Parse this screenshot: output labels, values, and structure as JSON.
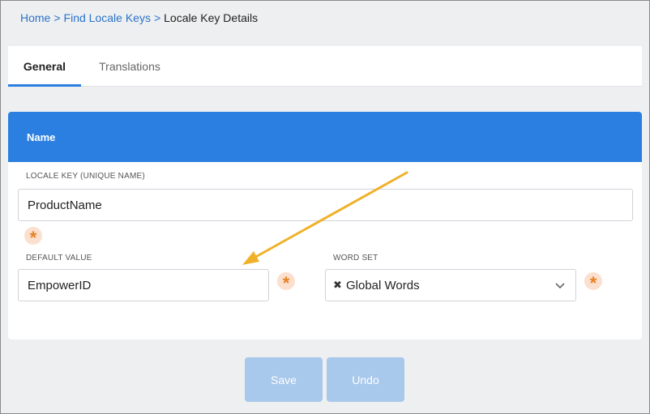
{
  "breadcrumb": {
    "home": "Home",
    "sep1": ">",
    "find": "Find Locale Keys",
    "sep2": ">",
    "current": "Locale Key Details"
  },
  "tabs": {
    "general": "General",
    "translations": "Translations"
  },
  "card": {
    "title": "Name",
    "locale_key": {
      "label": "LOCALE KEY (UNIQUE NAME)",
      "value": "ProductName"
    },
    "default_value": {
      "label": "DEFAULT VALUE",
      "value": "EmpowerID"
    },
    "word_set": {
      "label": "WORD SET",
      "clear": "✖",
      "value": "Global Words"
    },
    "required_mark": "*"
  },
  "actions": {
    "save": "Save",
    "undo": "Undo"
  },
  "colors": {
    "accent": "#2b7fe0",
    "link": "#2a73c9",
    "required": "#e8801f",
    "disabled_button": "#a8c8ec",
    "annotation_arrow": "#f0b12a"
  }
}
